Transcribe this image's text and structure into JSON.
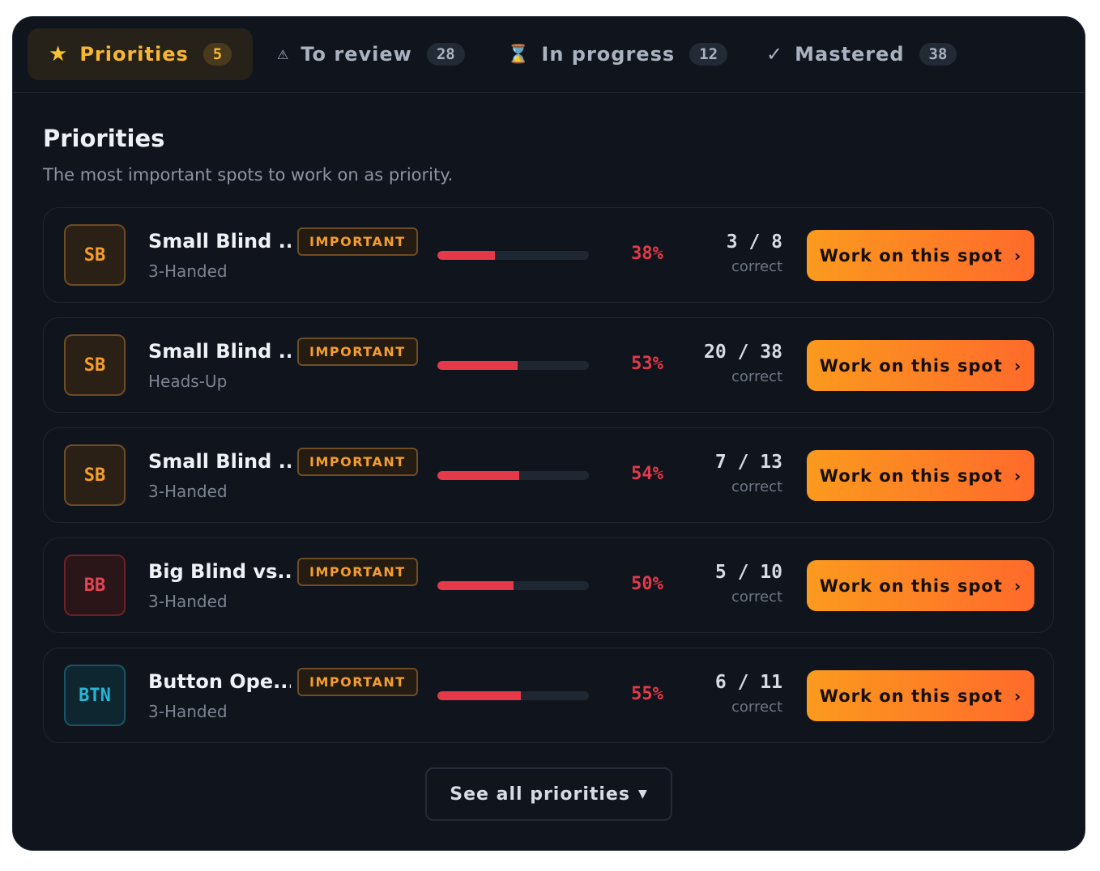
{
  "tabs": [
    {
      "label": "Priorities",
      "count": "5",
      "icon": "star-icon",
      "glyph": "★",
      "active": true
    },
    {
      "label": "To review",
      "count": "28",
      "icon": "warning-icon",
      "glyph": "⚠",
      "active": false
    },
    {
      "label": "In progress",
      "count": "12",
      "icon": "hourglass-icon",
      "glyph": "⌛",
      "active": false
    },
    {
      "label": "Mastered",
      "count": "38",
      "icon": "checkmark-icon",
      "glyph": "✓",
      "active": false
    }
  ],
  "section": {
    "title": "Priorities",
    "subtitle": "The most important spots to work on as priority."
  },
  "spots": [
    {
      "position": "SB",
      "title": "Small Blind ...",
      "format": "3-Handed",
      "badge": "IMPORTANT",
      "accuracy": 38,
      "percent_label": "38%",
      "correct": "3",
      "total": "8",
      "score_label": "correct",
      "cta": "Work on this spot"
    },
    {
      "position": "SB",
      "title": "Small Blind ...",
      "format": "Heads-Up",
      "badge": "IMPORTANT",
      "accuracy": 53,
      "percent_label": "53%",
      "correct": "20",
      "total": "38",
      "score_label": "correct",
      "cta": "Work on this spot"
    },
    {
      "position": "SB",
      "title": "Small Blind ...",
      "format": "3-Handed",
      "badge": "IMPORTANT",
      "accuracy": 54,
      "percent_label": "54%",
      "correct": "7",
      "total": "13",
      "score_label": "correct",
      "cta": "Work on this spot"
    },
    {
      "position": "BB",
      "title": "Big Blind vs...",
      "format": "3-Handed",
      "badge": "IMPORTANT",
      "accuracy": 50,
      "percent_label": "50%",
      "correct": "5",
      "total": "10",
      "score_label": "correct",
      "cta": "Work on this spot"
    },
    {
      "position": "BTN",
      "title": "Button Ope...",
      "format": "3-Handed",
      "badge": "IMPORTANT",
      "accuracy": 55,
      "percent_label": "55%",
      "correct": "6",
      "total": "11",
      "score_label": "correct",
      "cta": "Work on this spot"
    }
  ],
  "see_all_label": "See all priorities",
  "colors": {
    "accent_orange": "#fb9a1e",
    "accent_gold": "#f7b733",
    "accuracy_red": "#e5394a",
    "background": "#0f141d"
  }
}
